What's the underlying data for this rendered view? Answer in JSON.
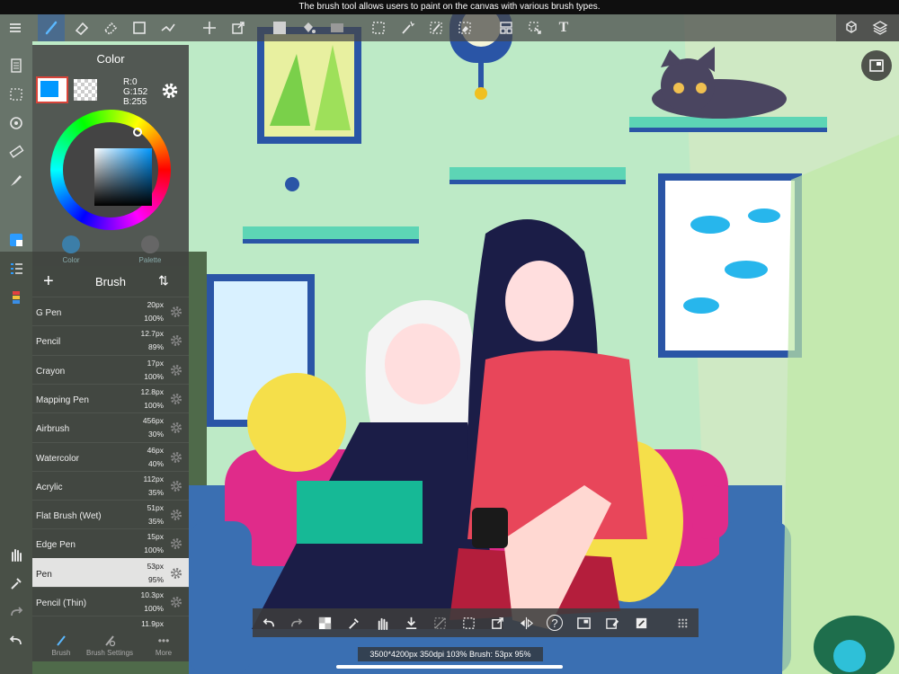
{
  "tooltip": "The brush tool allows users to paint on the canvas with various brush types.",
  "top_toolbar": {
    "items": [
      "menu-icon",
      "brush-tool-icon",
      "eraser-icon",
      "blur-eraser-icon",
      "select-rect-icon",
      "shape-line-icon",
      "move-icon",
      "transform-icon",
      "fill-color-icon",
      "bucket-icon",
      "gradient-icon",
      "select-icon",
      "magic-wand-icon",
      "select-pen-icon",
      "select-eraser-icon",
      "frame-icon",
      "hand-select-icon",
      "text-icon",
      "materials-icon",
      "layers-icon"
    ],
    "text_tool_glyph": "T"
  },
  "left_rail": {
    "items": [
      "page-icon",
      "select-dotted-icon",
      "rotate-icon",
      "ruler-icon",
      "pen-nib-icon",
      "color-panel-icon",
      "brush-list-icon",
      "palette-icon",
      "hand-icon",
      "eyedropper-icon",
      "redo-icon",
      "undo-icon"
    ]
  },
  "color_panel": {
    "title": "Color",
    "main_color": "#0098ff",
    "r": "R:0",
    "g": "G:152",
    "b": "B:255",
    "tabs": [
      {
        "label": "Color",
        "color": "#3c7ea8"
      },
      {
        "label": "Palette",
        "color": "#888888"
      }
    ]
  },
  "brush_panel": {
    "title": "Brush",
    "add": "+",
    "sort": "⇅",
    "brushes": [
      {
        "name": "G Pen",
        "size": "20px",
        "opacity": "100%"
      },
      {
        "name": "Pencil",
        "size": "12.7px",
        "opacity": "89%"
      },
      {
        "name": "Crayon",
        "size": "17px",
        "opacity": "100%"
      },
      {
        "name": "Mapping Pen",
        "size": "12.8px",
        "opacity": "100%"
      },
      {
        "name": "Airbrush",
        "size": "456px",
        "opacity": "30%"
      },
      {
        "name": "Watercolor",
        "size": "46px",
        "opacity": "40%"
      },
      {
        "name": "Acrylic",
        "size": "112px",
        "opacity": "35%"
      },
      {
        "name": "Flat Brush (Wet)",
        "size": "51px",
        "opacity": "35%"
      },
      {
        "name": "Edge Pen",
        "size": "15px",
        "opacity": "100%"
      },
      {
        "name": "Pen",
        "size": "53px",
        "opacity": "95%",
        "selected": true
      },
      {
        "name": "Pencil (Thin)",
        "size": "10.3px",
        "opacity": "100%"
      },
      {
        "name": "",
        "size": "11.9px",
        "opacity": ""
      }
    ],
    "bottom_tabs": [
      {
        "label": "Brush",
        "icon": "brush-icon"
      },
      {
        "label": "Brush Settings",
        "icon": "brush-settings-icon"
      },
      {
        "label": "More",
        "icon": "more-icon"
      }
    ],
    "more_glyph": "•••"
  },
  "bottom_bar": {
    "items": [
      "undo-icon",
      "redo-icon",
      "transparent-icon",
      "eyedropper-icon",
      "hand-icon",
      "save-icon",
      "deselect-icon",
      "select-all-icon",
      "transform-icon",
      "flip-icon",
      "help-icon",
      "frame-icon",
      "clear-icon",
      "fill-icon",
      "grid-icon"
    ],
    "help_glyph": "?"
  },
  "status": "3500*4200px 350dpi 103% Brush: 53px 95%"
}
